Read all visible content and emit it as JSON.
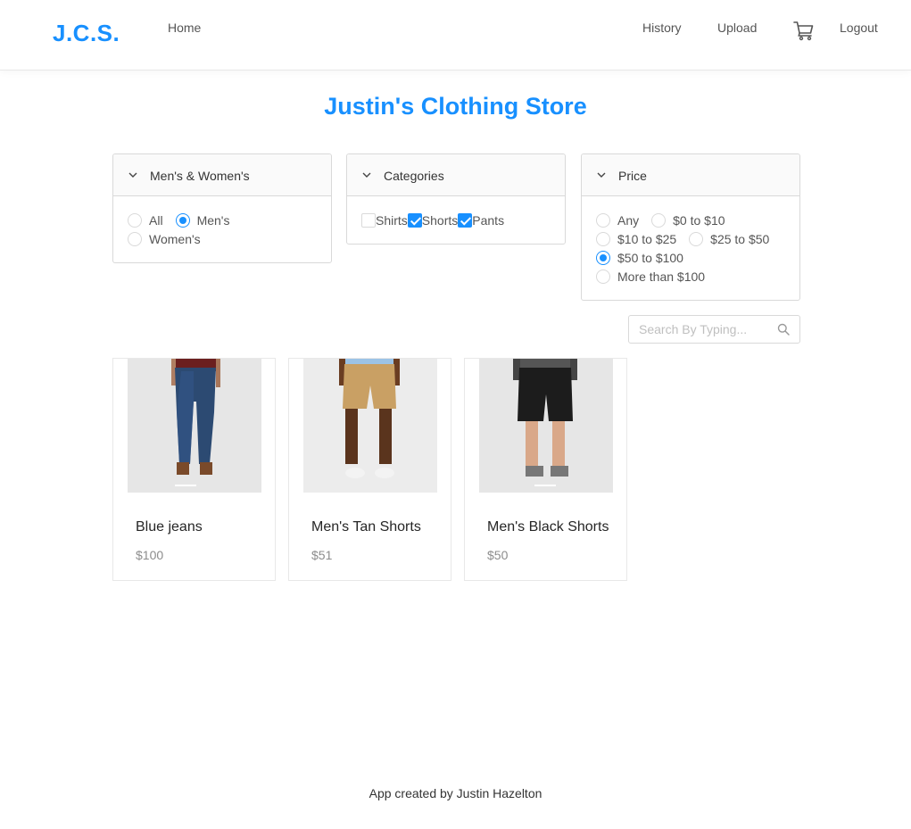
{
  "header": {
    "logo": "J.C.S.",
    "nav_left": [
      {
        "label": "Home"
      }
    ],
    "nav_right": [
      {
        "label": "History"
      },
      {
        "label": "Upload"
      }
    ],
    "cart_icon": "cart-icon",
    "logout_label": "Logout"
  },
  "page_title": "Justin's Clothing Store",
  "filters": {
    "gender": {
      "title": "Men's & Women's",
      "options": [
        "All",
        "Men's",
        "Women's"
      ],
      "selected": "Men's"
    },
    "categories": {
      "title": "Categories",
      "options": [
        {
          "label": "Shirts",
          "checked": false
        },
        {
          "label": "Shorts",
          "checked": true
        },
        {
          "label": "Pants",
          "checked": true
        }
      ]
    },
    "price": {
      "title": "Price",
      "options": [
        "Any",
        "$0 to $10",
        "$10 to $25",
        "$25 to $50",
        "$50 to $100",
        "More than $100"
      ],
      "selected": "$50 to $100"
    }
  },
  "search": {
    "placeholder": "Search By Typing..."
  },
  "products": [
    {
      "name": "Blue jeans",
      "price": "$100",
      "image": "blue-jeans"
    },
    {
      "name": "Men's Tan Shorts",
      "price": "$51",
      "image": "tan-shorts"
    },
    {
      "name": "Men's Black Shorts",
      "price": "$50",
      "image": "black-shorts"
    }
  ],
  "footer": "App created by Justin Hazelton",
  "colors": {
    "accent": "#1890ff",
    "border": "#d9d9d9",
    "muted_text": "#8c8c8c"
  }
}
